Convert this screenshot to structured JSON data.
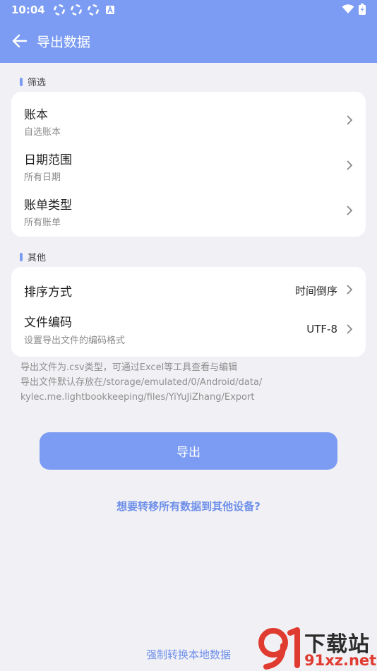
{
  "status_bar": {
    "time": "10:04",
    "icons": [
      "sync-icon",
      "sync-icon",
      "sync-icon",
      "a-badge-icon"
    ],
    "right_icons": [
      "wifi-icon",
      "battery-icon"
    ]
  },
  "app_bar": {
    "title": "导出数据",
    "back_icon": "arrow-left-icon"
  },
  "filter": {
    "label": "筛选",
    "rows": [
      {
        "label": "账本",
        "sub": "自选账本"
      },
      {
        "label": "日期范围",
        "sub": "所有日期"
      },
      {
        "label": "账单类型",
        "sub": "所有账单"
      }
    ]
  },
  "other": {
    "label": "其他",
    "rows": [
      {
        "label": "排序方式",
        "value": "时间倒序"
      },
      {
        "label": "文件编码",
        "sub": "设置导出文件的编码格式",
        "value": "UTF-8"
      }
    ]
  },
  "hints": [
    "导出文件为.csv类型，可通过Excel等工具查看与编辑",
    "导出文件默认存放在/storage/emulated/0/Android/data/",
    "kylec.me.lightbookkeeping/files/YiYuJiZhang/Export"
  ],
  "actions": {
    "export": "导出",
    "transfer": "想要转移所有数据到其他设备?",
    "force_convert": "强制转换本地数据"
  },
  "watermark": {
    "text_cn": "下载站",
    "text_en": "91xz.net"
  },
  "colors": {
    "primary": "#7b9cf2",
    "link": "#6e8fea",
    "background": "#f1f1f5"
  }
}
